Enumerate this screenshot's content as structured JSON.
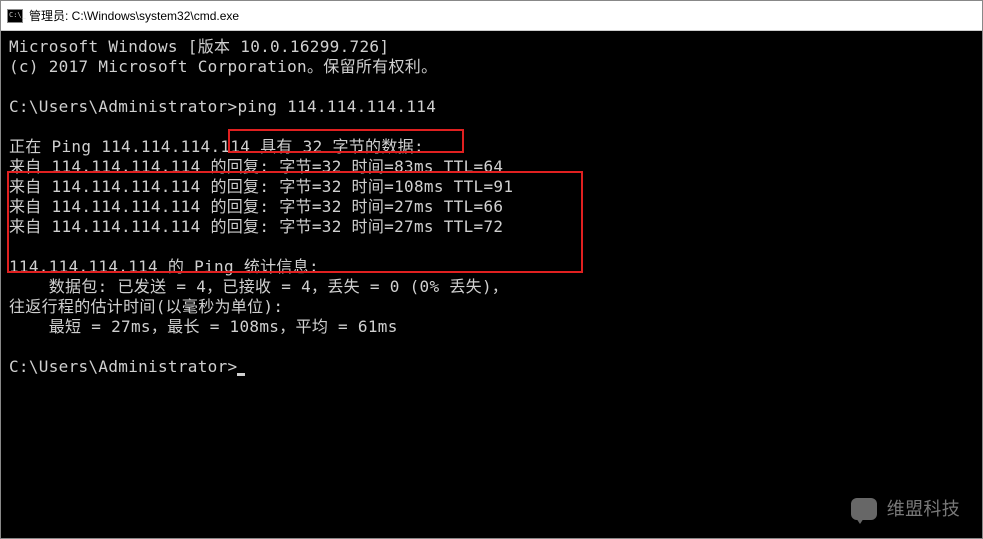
{
  "window": {
    "title": "管理员: C:\\Windows\\system32\\cmd.exe"
  },
  "terminal": {
    "header1": "Microsoft Windows [版本 10.0.16299.726]",
    "header2": "(c) 2017 Microsoft Corporation。保留所有权利。",
    "prompt1_path": "C:\\Users\\Administrator>",
    "command1": "ping 114.114.114.114",
    "ping_start": "正在 Ping 114.114.114.114 具有 32 字节的数据:",
    "reply1": "来自 114.114.114.114 的回复: 字节=32 时间=83ms TTL=64",
    "reply2": "来自 114.114.114.114 的回复: 字节=32 时间=108ms TTL=91",
    "reply3": "来自 114.114.114.114 的回复: 字节=32 时间=27ms TTL=66",
    "reply4": "来自 114.114.114.114 的回复: 字节=32 时间=27ms TTL=72",
    "stats_head": "114.114.114.114 的 Ping 统计信息:",
    "stats_packets": "    数据包: 已发送 = 4，已接收 = 4，丢失 = 0 (0% 丢失)，",
    "stats_rtt_head": "往返行程的估计时间(以毫秒为单位):",
    "stats_rtt": "    最短 = 27ms，最长 = 108ms，平均 = 61ms",
    "prompt2_path": "C:\\Users\\Administrator>"
  },
  "watermark": {
    "text": "维盟科技"
  }
}
